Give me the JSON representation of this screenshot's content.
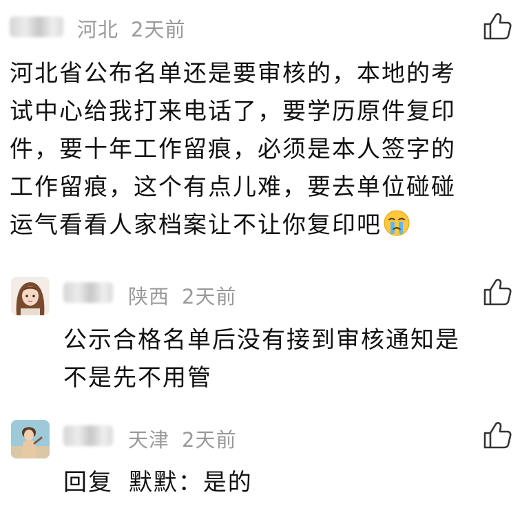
{
  "comments": [
    {
      "location": "河北",
      "time": "2天前",
      "lines": [
        "河北省公布名单还是要审核的，本地的考",
        "试中心给我打来电话了，要学历原件复印",
        "件，要十年工作留痕，必须是本人签字的",
        "工作留痕，这个有点儿难，要去单位碰碰",
        "运气看看人家档案让不让你复印吧"
      ],
      "trailing_emoji": "crying-face-emoji"
    },
    {
      "location": "陕西",
      "time": "2天前",
      "lines": [
        "公示合格名单后没有接到审核通知是",
        "不是先不用管"
      ]
    },
    {
      "location": "天津",
      "time": "2天前",
      "reply_prefix": "回复",
      "reply_target": "默默：",
      "reply_text": "是的"
    }
  ],
  "icons": {
    "like": "thumbs-up-icon"
  },
  "colors": {
    "meta_text": "#9a9a9a",
    "body_text": "#111111",
    "background": "#ffffff"
  }
}
